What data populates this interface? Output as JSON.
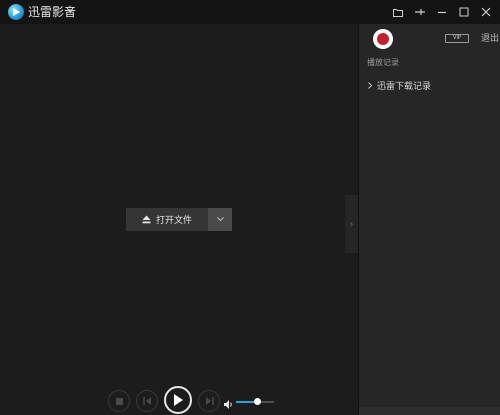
{
  "app": {
    "title": "迅雷影音",
    "caret": "▾"
  },
  "titlebar": {
    "icons": [
      "folder-icon",
      "pin-icon",
      "minimize-icon",
      "restore-icon",
      "close-icon"
    ]
  },
  "player": {
    "open_button_label": "打开文件",
    "dropdown_icon": "chevron-down-icon",
    "volume_level": 0.55
  },
  "sidebar": {
    "username": "",
    "vip_badge": "VIP",
    "logout_label": "退出",
    "history_heading": "播放记录",
    "tree_items": [
      {
        "label": "迅雷下载记录",
        "expanded": false
      }
    ]
  },
  "colors": {
    "accent": "#2aa1e0",
    "background": "#1c1c1c",
    "sidebar_bg": "#262626",
    "titlebar_bg": "#141414"
  }
}
